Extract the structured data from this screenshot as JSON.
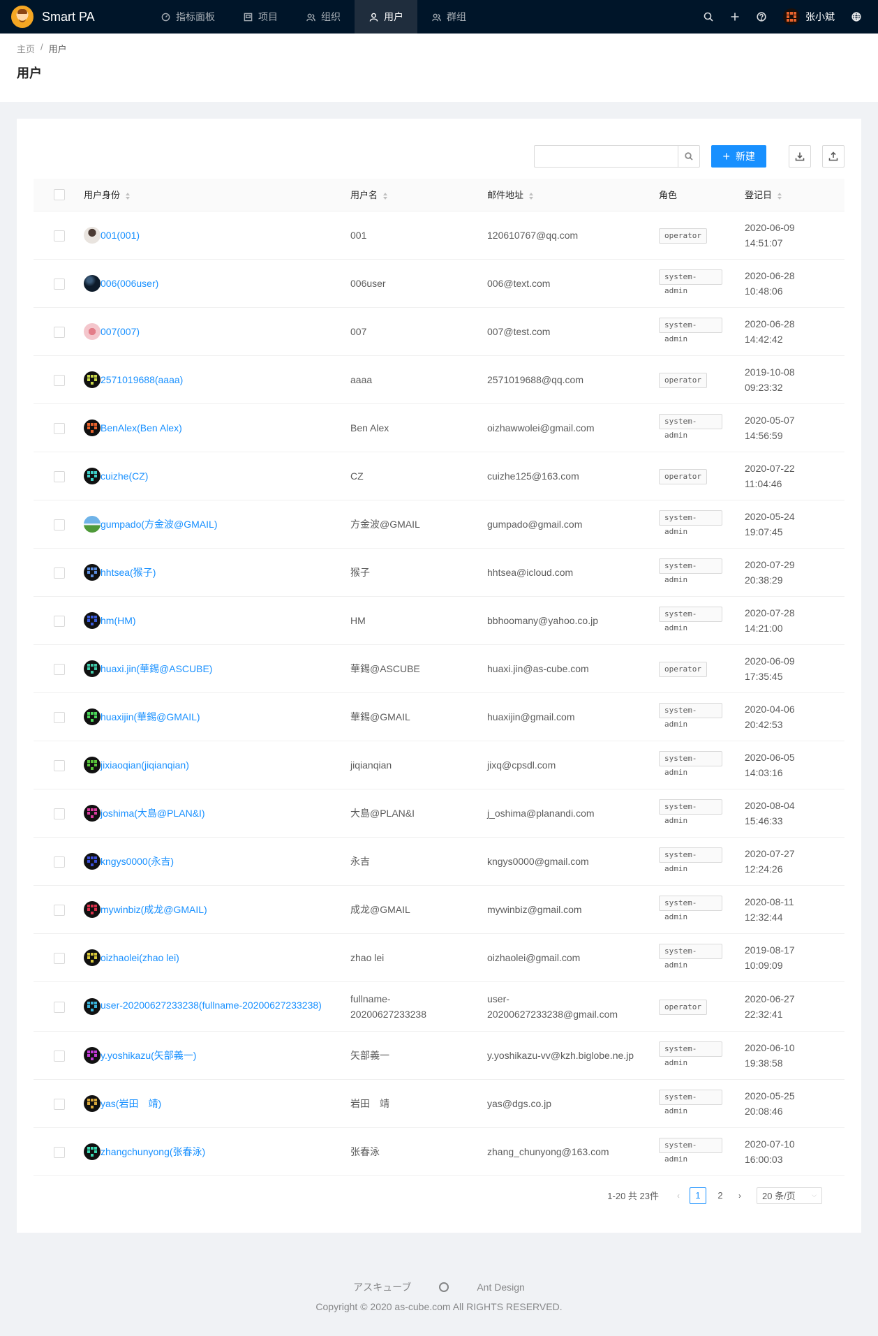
{
  "app": {
    "title": "Smart PA"
  },
  "nav": [
    {
      "label": "指标面板",
      "icon": "dashboard-icon"
    },
    {
      "label": "项目",
      "icon": "project-icon"
    },
    {
      "label": "组织",
      "icon": "team-icon"
    },
    {
      "label": "用户",
      "icon": "user-icon",
      "active": true
    },
    {
      "label": "群组",
      "icon": "group-icon"
    }
  ],
  "header_actions": {
    "user_name": "张小斌"
  },
  "breadcrumb": {
    "home": "主页",
    "separator": "/",
    "current": "用户"
  },
  "page": {
    "title": "用户"
  },
  "toolbar": {
    "search_placeholder": "",
    "search_value": "",
    "new_label": "新建"
  },
  "table": {
    "columns": {
      "uid": "用户身份",
      "name": "用户名",
      "email": "邮件地址",
      "role": "角色",
      "date": "登记日"
    },
    "rows": [
      {
        "uid": "001(001)",
        "name": "001",
        "email": "120610767@qq.com",
        "role": "operator",
        "date": "2020-06-09\n14:51:07",
        "avatar": "photo"
      },
      {
        "uid": "006(006user)",
        "name": "006user",
        "email": "006@text.com",
        "role": "system-admin",
        "date": "2020-06-28\n10:48:06",
        "avatar": "night"
      },
      {
        "uid": "007(007)",
        "name": "007",
        "email": "007@test.com",
        "role": "system-admin",
        "date": "2020-06-28\n14:42:42",
        "avatar": "flower"
      },
      {
        "uid": "2571019688(aaaa)",
        "name": "aaaa",
        "email": "2571019688@qq.com",
        "role": "operator",
        "date": "2019-10-08\n09:23:32",
        "avatar": "pixel",
        "color": "#c9d84a"
      },
      {
        "uid": "BenAlex(Ben Alex)",
        "name": "Ben Alex",
        "email": "oizhawwolei@gmail.com",
        "role": "system-admin",
        "date": "2020-05-07\n14:56:59",
        "avatar": "pixel",
        "color": "#e8622c"
      },
      {
        "uid": "cuizhe(CZ)",
        "name": "CZ",
        "email": "cuizhe125@163.com",
        "role": "operator",
        "date": "2020-07-22\n11:04:46",
        "avatar": "pixel",
        "color": "#3fd0c9"
      },
      {
        "uid": "gumpado(方金波@GMAIL)",
        "name": "方金波@GMAIL",
        "email": "gumpado@gmail.com",
        "role": "system-admin",
        "date": "2020-05-24\n19:07:45",
        "avatar": "land"
      },
      {
        "uid": "hhtsea(猴子)",
        "name": "猴子",
        "email": "hhtsea@icloud.com",
        "role": "system-admin",
        "date": "2020-07-29\n20:38:29",
        "avatar": "pixel",
        "color": "#5b8de0"
      },
      {
        "uid": "hm(HM)",
        "name": "HM",
        "email": "bbhoomany@yahoo.co.jp",
        "role": "system-admin",
        "date": "2020-07-28\n14:21:00",
        "avatar": "pixel",
        "color": "#3a5bd9"
      },
      {
        "uid": "huaxi.jin(華錫@ASCUBE)",
        "name": "華錫@ASCUBE",
        "email": "huaxi.jin@as-cube.com",
        "role": "operator",
        "date": "2020-06-09\n17:35:45",
        "avatar": "pixel",
        "color": "#3fc9a8"
      },
      {
        "uid": "huaxijin(華錫@GMAIL)",
        "name": "華錫@GMAIL",
        "email": "huaxijin@gmail.com",
        "role": "system-admin",
        "date": "2020-04-06\n20:42:53",
        "avatar": "pixel",
        "color": "#4bd65a"
      },
      {
        "uid": "jixiaoqian(jiqianqian)",
        "name": "jiqianqian",
        "email": "jixq@cpsdl.com",
        "role": "system-admin",
        "date": "2020-06-05\n14:03:16",
        "avatar": "pixel",
        "color": "#58c43a"
      },
      {
        "uid": "joshima(大島@PLAN&I)",
        "name": "大島@PLAN&I",
        "email": "j_oshima@planandi.com",
        "role": "system-admin",
        "date": "2020-08-04\n15:46:33",
        "avatar": "pixel",
        "color": "#d93ba0"
      },
      {
        "uid": "kngys0000(永吉)",
        "name": "永吉",
        "email": "kngys0000@gmail.com",
        "role": "system-admin",
        "date": "2020-07-27\n12:24:26",
        "avatar": "pixel",
        "color": "#3a4fd9"
      },
      {
        "uid": "mywinbiz(成龙@GMAIL)",
        "name": "成龙@GMAIL",
        "email": "mywinbiz@gmail.com",
        "role": "system-admin",
        "date": "2020-08-11\n12:32:44",
        "avatar": "pixel",
        "color": "#d9304a"
      },
      {
        "uid": "oizhaolei(zhao lei)",
        "name": "zhao lei",
        "email": "oizhaolei@gmail.com",
        "role": "system-admin",
        "date": "2019-08-17\n10:09:09",
        "avatar": "pixel",
        "color": "#d9c83a"
      },
      {
        "uid": "user-20200627233238(fullname-20200627233238)",
        "name": "fullname-20200627233238",
        "email": "user-20200627233238@gmail.com",
        "role": "operator",
        "date": "2020-06-27\n22:32:41",
        "avatar": "pixel",
        "color": "#3ab2d9"
      },
      {
        "uid": "y.yoshikazu(矢部義一)",
        "name": "矢部義一",
        "email": "y.yoshikazu-vv@kzh.biglobe.ne.jp",
        "role": "system-admin",
        "date": "2020-06-10\n19:38:58",
        "avatar": "pixel",
        "color": "#c43ad9"
      },
      {
        "uid": "yas(岩田　靖)",
        "name": "岩田　靖",
        "email": "yas@dgs.co.jp",
        "role": "system-admin",
        "date": "2020-05-25\n20:08:46",
        "avatar": "pixel",
        "color": "#d9a83a"
      },
      {
        "uid": "zhangchunyong(张春泳)",
        "name": "张春泳",
        "email": "zhang_chunyong@163.com",
        "role": "system-admin",
        "date": "2020-07-10\n16:00:03",
        "avatar": "pixel",
        "color": "#3ad9b2"
      }
    ]
  },
  "pagination": {
    "total_text": "1-20 共 23件",
    "pages": [
      "1",
      "2"
    ],
    "current": "1",
    "page_size": "20 条/页"
  },
  "footer": {
    "link1": "アスキューブ",
    "link3": "Ant Design",
    "copyright": "Copyright © 2020 as-cube.com All RIGHTS RESERVED."
  },
  "colors": {
    "nav_bg": "#001529",
    "primary": "#1890ff",
    "link": "#1890ff"
  }
}
